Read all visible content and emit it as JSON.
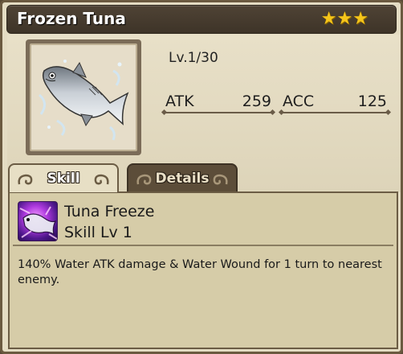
{
  "item": {
    "name": "Frozen Tuna",
    "stars": [
      "★",
      "★",
      "★"
    ],
    "level": "Lv.1/30"
  },
  "stats": {
    "atk_label": "ATK",
    "atk_value": "259",
    "acc_label": "ACC",
    "acc_value": "125"
  },
  "tabs": {
    "skill": "Skill",
    "details": "Details",
    "active": "skill"
  },
  "skill": {
    "name": "Tuna Freeze",
    "level": "Skill Lv 1",
    "description": "140% Water ATK damage & Water Wound for 1 turn to nearest enemy."
  },
  "colors": {
    "star": "#f5c51b",
    "header": "#4f4335",
    "panel": "#d6cca8",
    "skill_icon": "#b03be0"
  },
  "icons": {
    "portrait": "frozen-tuna-fish-icon",
    "skill": "tuna-freeze-skill-icon"
  }
}
